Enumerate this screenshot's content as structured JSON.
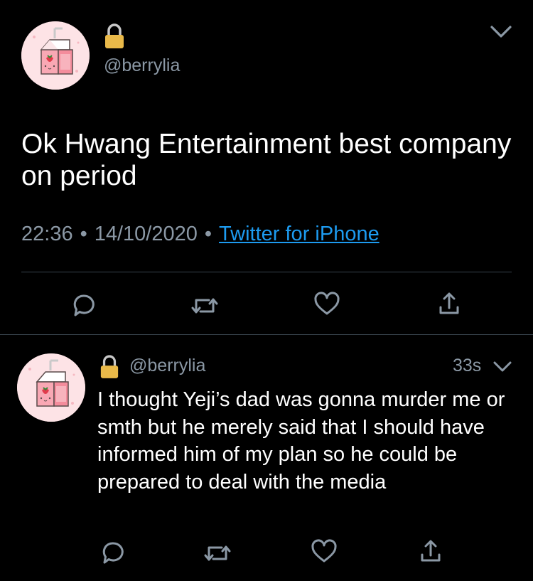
{
  "main_tweet": {
    "handle": "@berrylia",
    "locked": true,
    "text": "Ok Hwang Entertainment best company on period",
    "time": "22:36",
    "separator": "•",
    "date": "14/10/2020",
    "source": "Twitter for iPhone"
  },
  "reply_tweet": {
    "handle": "@berrylia",
    "locked": true,
    "age": "33s",
    "text": "I thought Yeji’s dad was gonna murder me or smth but he merely said that I should have informed him of my plan so he could be prepared to deal with the media"
  },
  "icons": {
    "reply": "speech-bubble-icon",
    "retweet": "retweet-icon",
    "like": "heart-icon",
    "share": "share-icon",
    "lock": "lock-icon",
    "chevron": "chevron-down-icon",
    "avatar": "strawberry-milk-carton"
  },
  "colors": {
    "background": "#000000",
    "text": "#ffffff",
    "secondary_text": "#8b98a5",
    "link": "#1d9bf0",
    "divider": "#38444d",
    "icon": "#8b98a5",
    "avatar_bg": "#fde3e6",
    "lock_gold": "#e9b949"
  }
}
